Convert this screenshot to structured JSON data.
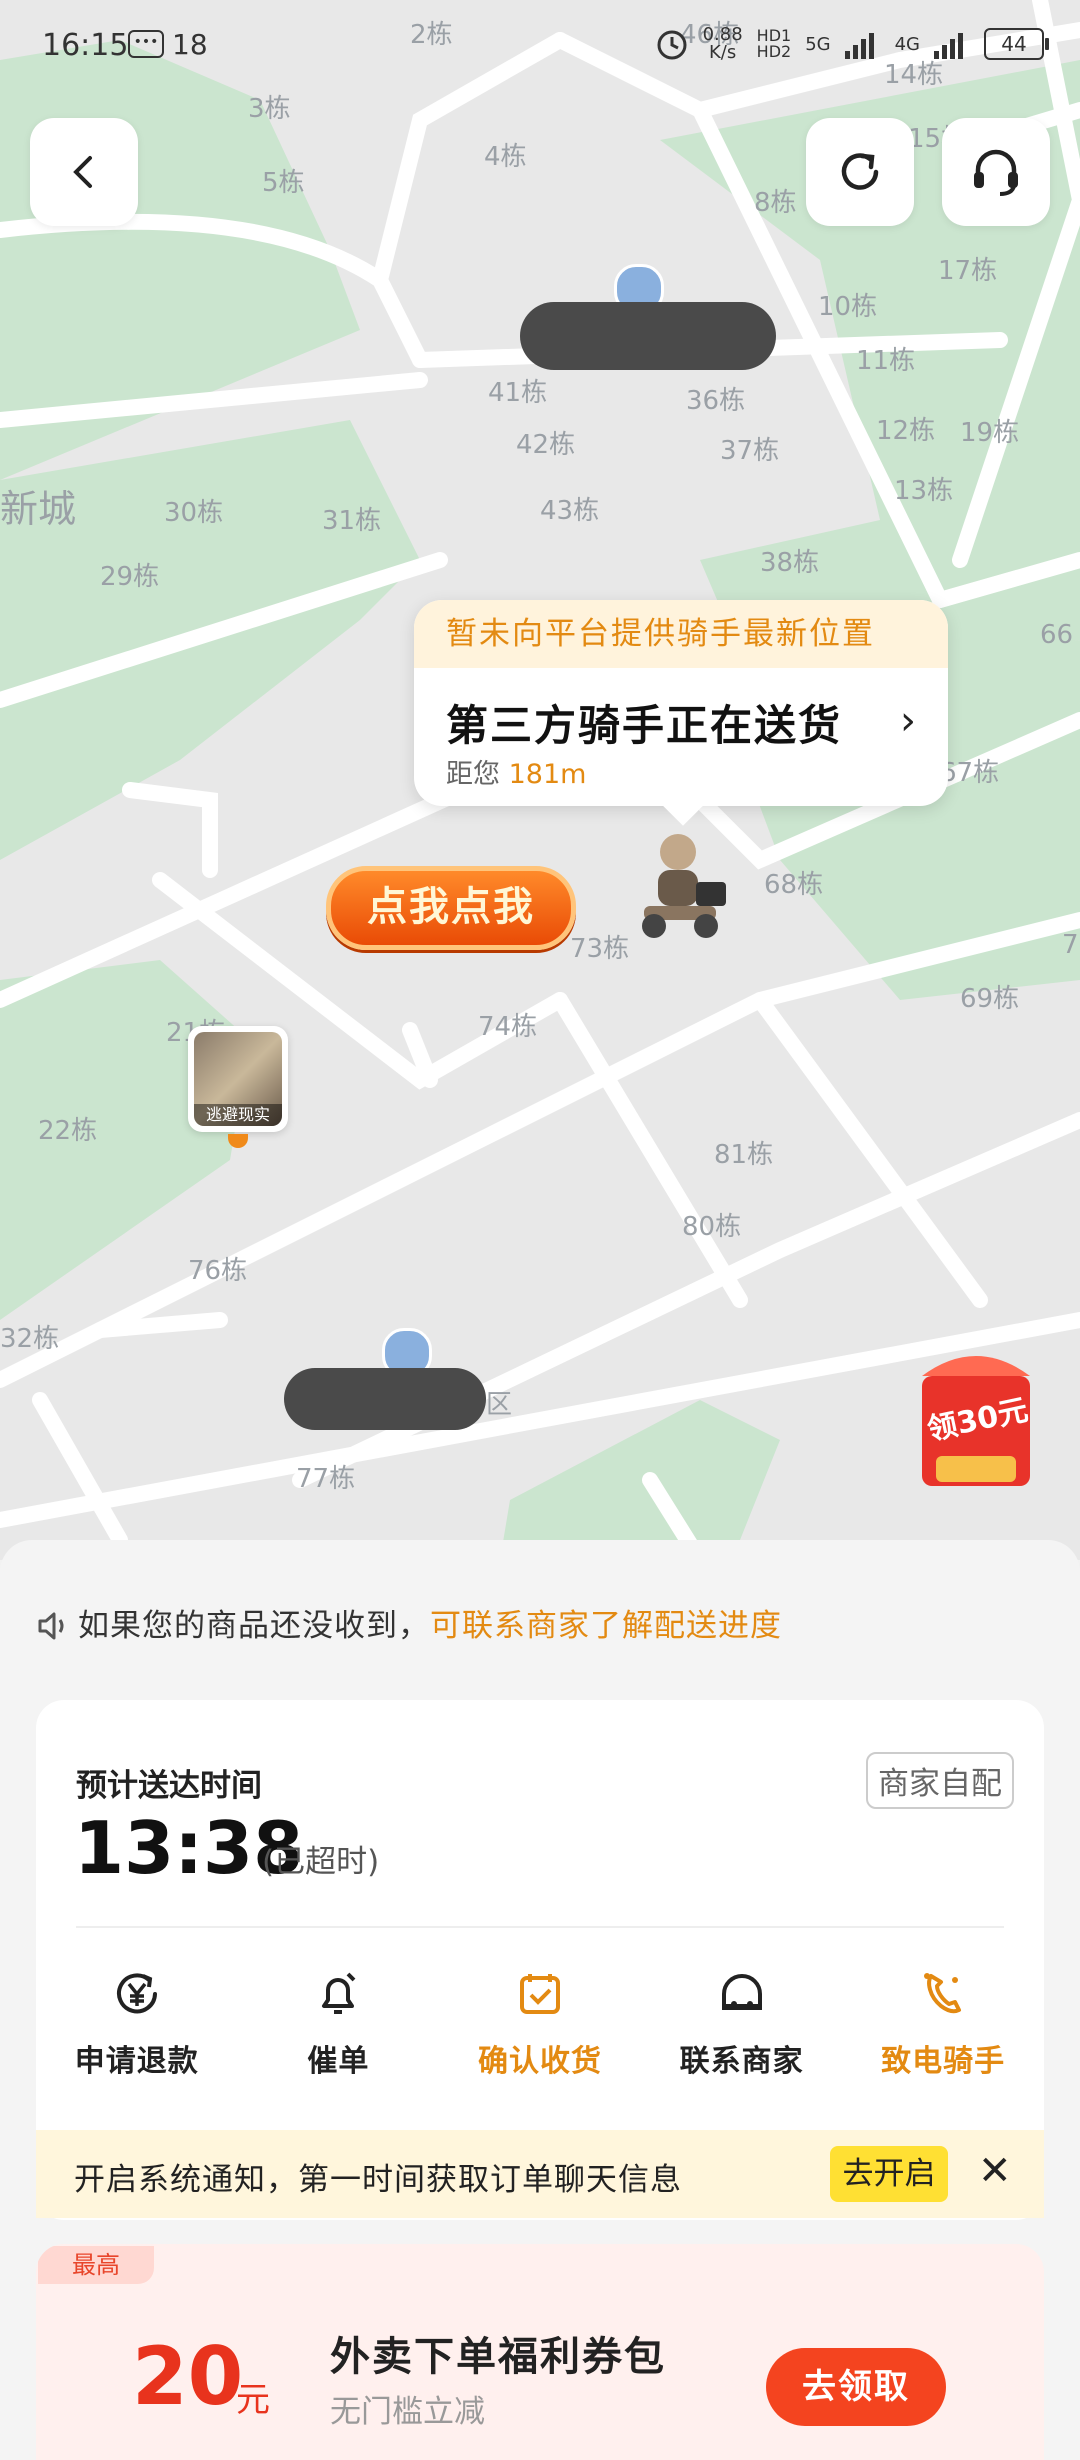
{
  "status_bar": {
    "time": "16:15",
    "notification_count": "18",
    "speed": "0.88",
    "speed_unit": "K/s",
    "network": "5G",
    "network2": "4G",
    "battery": "44"
  },
  "map": {
    "building_labels": [
      "2栋",
      "3栋",
      "4栋",
      "5栋",
      "46栋",
      "14栋",
      "15栋",
      "8栋",
      "17栋",
      "10栋",
      "41栋",
      "36栋",
      "11栋",
      "42栋",
      "37栋",
      "12栋",
      "19栋",
      "30栋",
      "31栋",
      "43栋",
      "13栋",
      "29栋",
      "38栋",
      "66",
      "67栋",
      "68栋",
      "73栋",
      "7",
      "74栋",
      "69栋",
      "21栋",
      "22栋",
      "81栋",
      "80栋",
      "76栋",
      "32栋",
      "77栋",
      "区"
    ],
    "area_name": "新城",
    "click_me_button": "点我点我",
    "pin_caption": "逃避现实",
    "coupon_badge": "领30元"
  },
  "rider_bubble": {
    "header": "暂未向平台提供骑手最新位置",
    "title": "第三方骑手正在送货",
    "distance_prefix": "距您",
    "distance_value": "181m"
  },
  "tip": {
    "text": "如果您的商品还没收到，",
    "link": "可联系商家了解配送进度"
  },
  "delivery_card": {
    "eta_label": "预计送达时间",
    "eta_time": "13:38",
    "eta_note": "(已超时)",
    "merchant_tag": "商家自配",
    "actions": [
      {
        "label": "申请退款",
        "icon": "refund-icon"
      },
      {
        "label": "催单",
        "icon": "bell-icon"
      },
      {
        "label": "确认收货",
        "icon": "calendar-check-icon"
      },
      {
        "label": "联系商家",
        "icon": "store-icon"
      },
      {
        "label": "致电骑手",
        "icon": "phone-icon"
      }
    ]
  },
  "notice": {
    "text": "开启系统通知，第一时间获取订单聊天信息",
    "button": "去开启",
    "close": "✕"
  },
  "coupon": {
    "badge": "最高",
    "amount": "20",
    "unit": "元",
    "title": "外卖下单福利券包",
    "subtitle": "无门槛立减",
    "button": "去领取"
  },
  "colors": {
    "accent_orange": "#e38a12",
    "red": "#e8331d",
    "map_green": "#c9e4cf"
  }
}
